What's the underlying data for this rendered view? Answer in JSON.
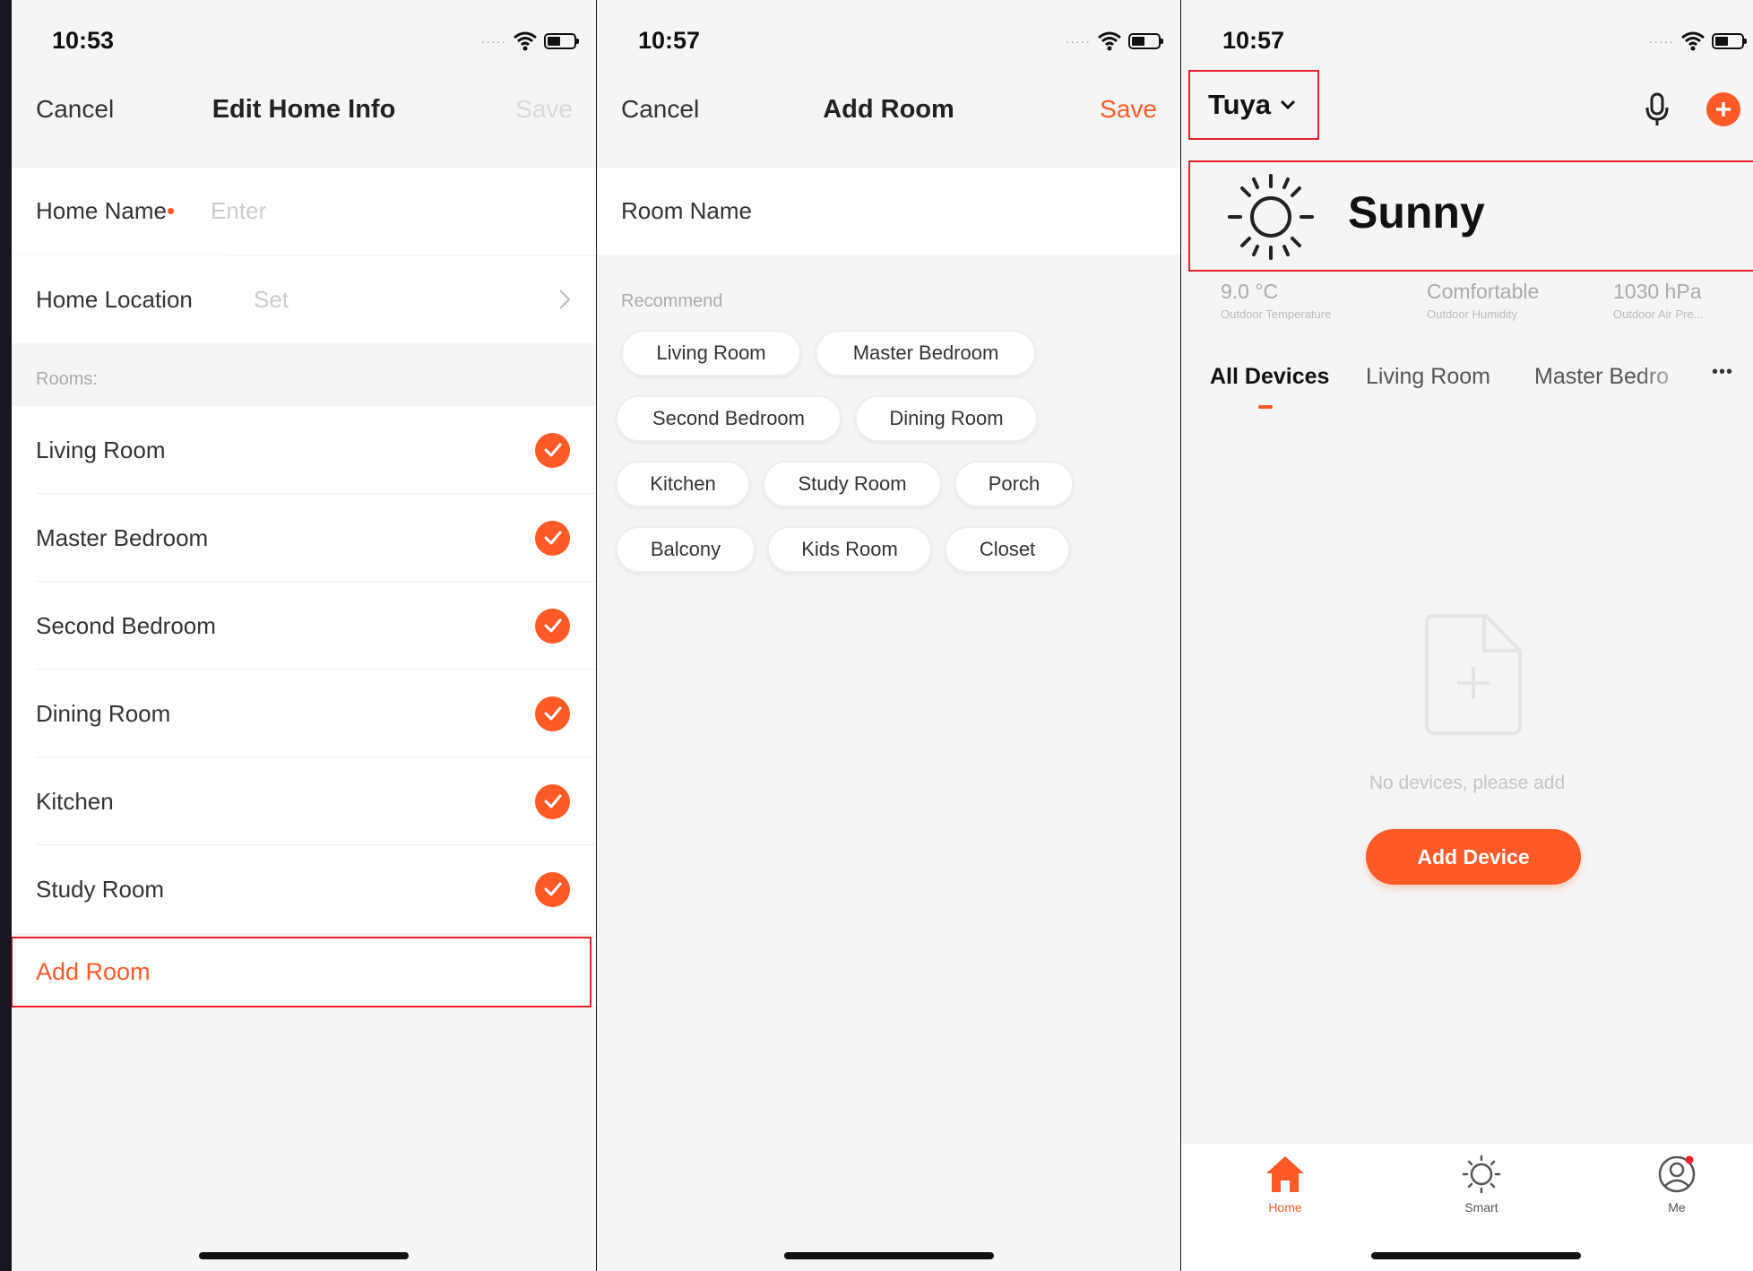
{
  "screen1": {
    "time": "10:53",
    "nav": {
      "cancel": "Cancel",
      "title": "Edit Home Info",
      "save": "Save"
    },
    "home_name": {
      "label": "Home Name",
      "required_mark": "•",
      "placeholder": "Enter"
    },
    "home_location": {
      "label": "Home Location",
      "placeholder": "Set"
    },
    "rooms_header": "Rooms:",
    "rooms": [
      "Living Room",
      "Master Bedroom",
      "Second Bedroom",
      "Dining Room",
      "Kitchen",
      "Study Room"
    ],
    "add_room": "Add Room"
  },
  "screen2": {
    "time": "10:57",
    "nav": {
      "cancel": "Cancel",
      "title": "Add Room",
      "save": "Save"
    },
    "room_name_placeholder": "Room Name",
    "recommend_header": "Recommend",
    "chips": [
      "Living Room",
      "Master Bedroom",
      "Second Bedroom",
      "Dining Room",
      "Kitchen",
      "Study Room",
      "Porch",
      "Balcony",
      "Kids Room",
      "Closet"
    ]
  },
  "screen3": {
    "time": "10:57",
    "home_selector": "Tuya",
    "weather": {
      "condition": "Sunny",
      "temperature": "9.0 °C",
      "temperature_label": "Outdoor Temperature",
      "humidity": "Comfortable",
      "humidity_label": "Outdoor Humidity",
      "pressure": "1030 hPa",
      "pressure_label": "Outdoor Air Pre..."
    },
    "tabs": [
      "All Devices",
      "Living Room",
      "Master Bedro"
    ],
    "more": "•••",
    "empty_text": "No devices, please add",
    "add_device": "Add Device",
    "bottom_tabs": [
      {
        "label": "Home",
        "icon": "home-icon"
      },
      {
        "label": "Smart",
        "icon": "smart-icon"
      },
      {
        "label": "Me",
        "icon": "user-icon"
      }
    ]
  },
  "colors": {
    "accent": "#ff5a28",
    "highlight_box": "#e8202a",
    "background": "#15161e"
  }
}
